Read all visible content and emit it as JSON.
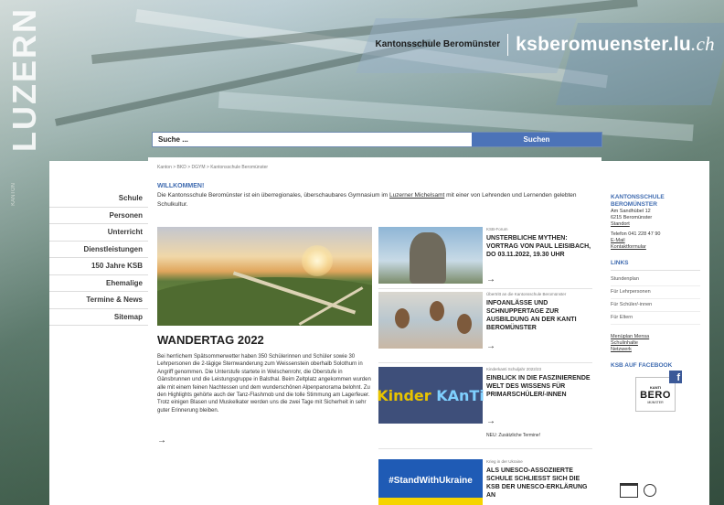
{
  "brand": {
    "vertical_logo": "LUZERN",
    "vertical_small": "KANTON",
    "school_name": "Kantonsschule Beromünster",
    "domain_main": "ksberomuenster.lu",
    "domain_suffix": ".ch"
  },
  "search": {
    "placeholder": "Suche ...",
    "button_label": "Suchen"
  },
  "leftnav": {
    "items": [
      {
        "label": "Schule"
      },
      {
        "label": "Personen"
      },
      {
        "label": "Unterricht"
      },
      {
        "label": "Dienstleistungen"
      },
      {
        "label": "150 Jahre KSB"
      },
      {
        "label": "Ehemalige"
      },
      {
        "label": "Termine & News"
      },
      {
        "label": "Sitemap"
      }
    ]
  },
  "main": {
    "breadcrumb": "Kanton  >  BKD  >  DGYM  >  Kantonsschule Beromünster",
    "welcome_heading": "WILLKOMMEN!",
    "welcome_text_before": "Die Kantonsschule Beromünster ist ein überregionales, überschaubares Gymnasium im ",
    "welcome_link": "Luzerner Michelsamt",
    "welcome_text_after": " mit einer von Lehrenden und Lernenden gelebten Schulkultur.",
    "lead_title": "WANDERTAG 2022",
    "lead_text": "Bei herrlichem Spätsommerwetter haben 350 Schülerinnen und Schüler sowie 30 Lehrpersonen die 2-tägige Sternwanderung zum Weissenstein oberhalb Solothurn in Angriff genommen. Die Unterstufe startete in Welschenrohr, die Oberstufe in Gänsbrunnen und die Leistungsgruppe in Balsthal. Beim Zeltplatz angekommen wurden alle mit einem feinen Nachtessen und dem wunderschönen Alpenpanorama belohnt. Zu den Highlights gehörte auch der Tanz-Flashmob und die tolle Stimmung am Lagerfeuer. Trotz einigen Blasen und Muskelkater werden uns die zwei Tage mit Sicherheit in sehr guter Erinnerung bleiben.",
    "arrow": "→"
  },
  "news": [
    {
      "meta": "KSB-Forum",
      "title": "UNSTERBLICHE MYTHEN: VORTRAG VON PAUL LEISIBACH, DO 03.11.2022, 19.30 UHR",
      "arrow": "→"
    },
    {
      "meta": "Übertritt an die Kantonsschule Beromünster",
      "title": "INFOANLÄSSE UND SCHNUPPERTAGE ZUR AUSBILDUNG AN DER KANTI BEROMÜNSTER",
      "arrow": "→"
    },
    {
      "meta": "Kinderkanti Schuljahr 2022/23",
      "title": "EINBLICK IN DIE FASZINIERENDE WELT DES WISSENS FÜR PRIMARSCHÜLER/-INNEN",
      "arrow": "→",
      "note": "NEU: Zusätzliche Termine!",
      "thumb_text_a": "Kinder",
      "thumb_text_b": "KAnTi"
    },
    {
      "meta": "Krieg in der Ukraine",
      "title": "ALS UNESCO-ASSOZIIERTE SCHULE SCHLIESST SICH DIE KSB DER UNESCO-ERKLÄRUNG AN",
      "arrow": "→",
      "thumb_text": "#StandWithUkraine"
    }
  ],
  "rightbar": {
    "contact_heading": "KANTONSSCHULE BEROMÜNSTER",
    "address1": "Am Sandhübel 12",
    "address2": "6215 Beromünster",
    "standort": "Standort",
    "phone": "Telefon 041 228 47 90",
    "email": "E-Mail",
    "contact_form": "Kontaktformular",
    "links_heading": "LINKS",
    "links": [
      "Stundenplan",
      "Für Lehrpersonen",
      "Für Schüler/-innen",
      "Für Eltern"
    ],
    "links2": [
      "Menüplan Mensa",
      "Schulinhalte",
      "Netzwerk"
    ],
    "facebook_heading": "KSB AUF FACEBOOK",
    "fb_logo_top": "KANTI",
    "fb_logo_main": "BERO",
    "fb_logo_bottom": "MÜNSTER",
    "fb_icon": "f"
  },
  "colors": {
    "accent_blue": "#3f6bb0",
    "search_button": "#4c73b8"
  }
}
